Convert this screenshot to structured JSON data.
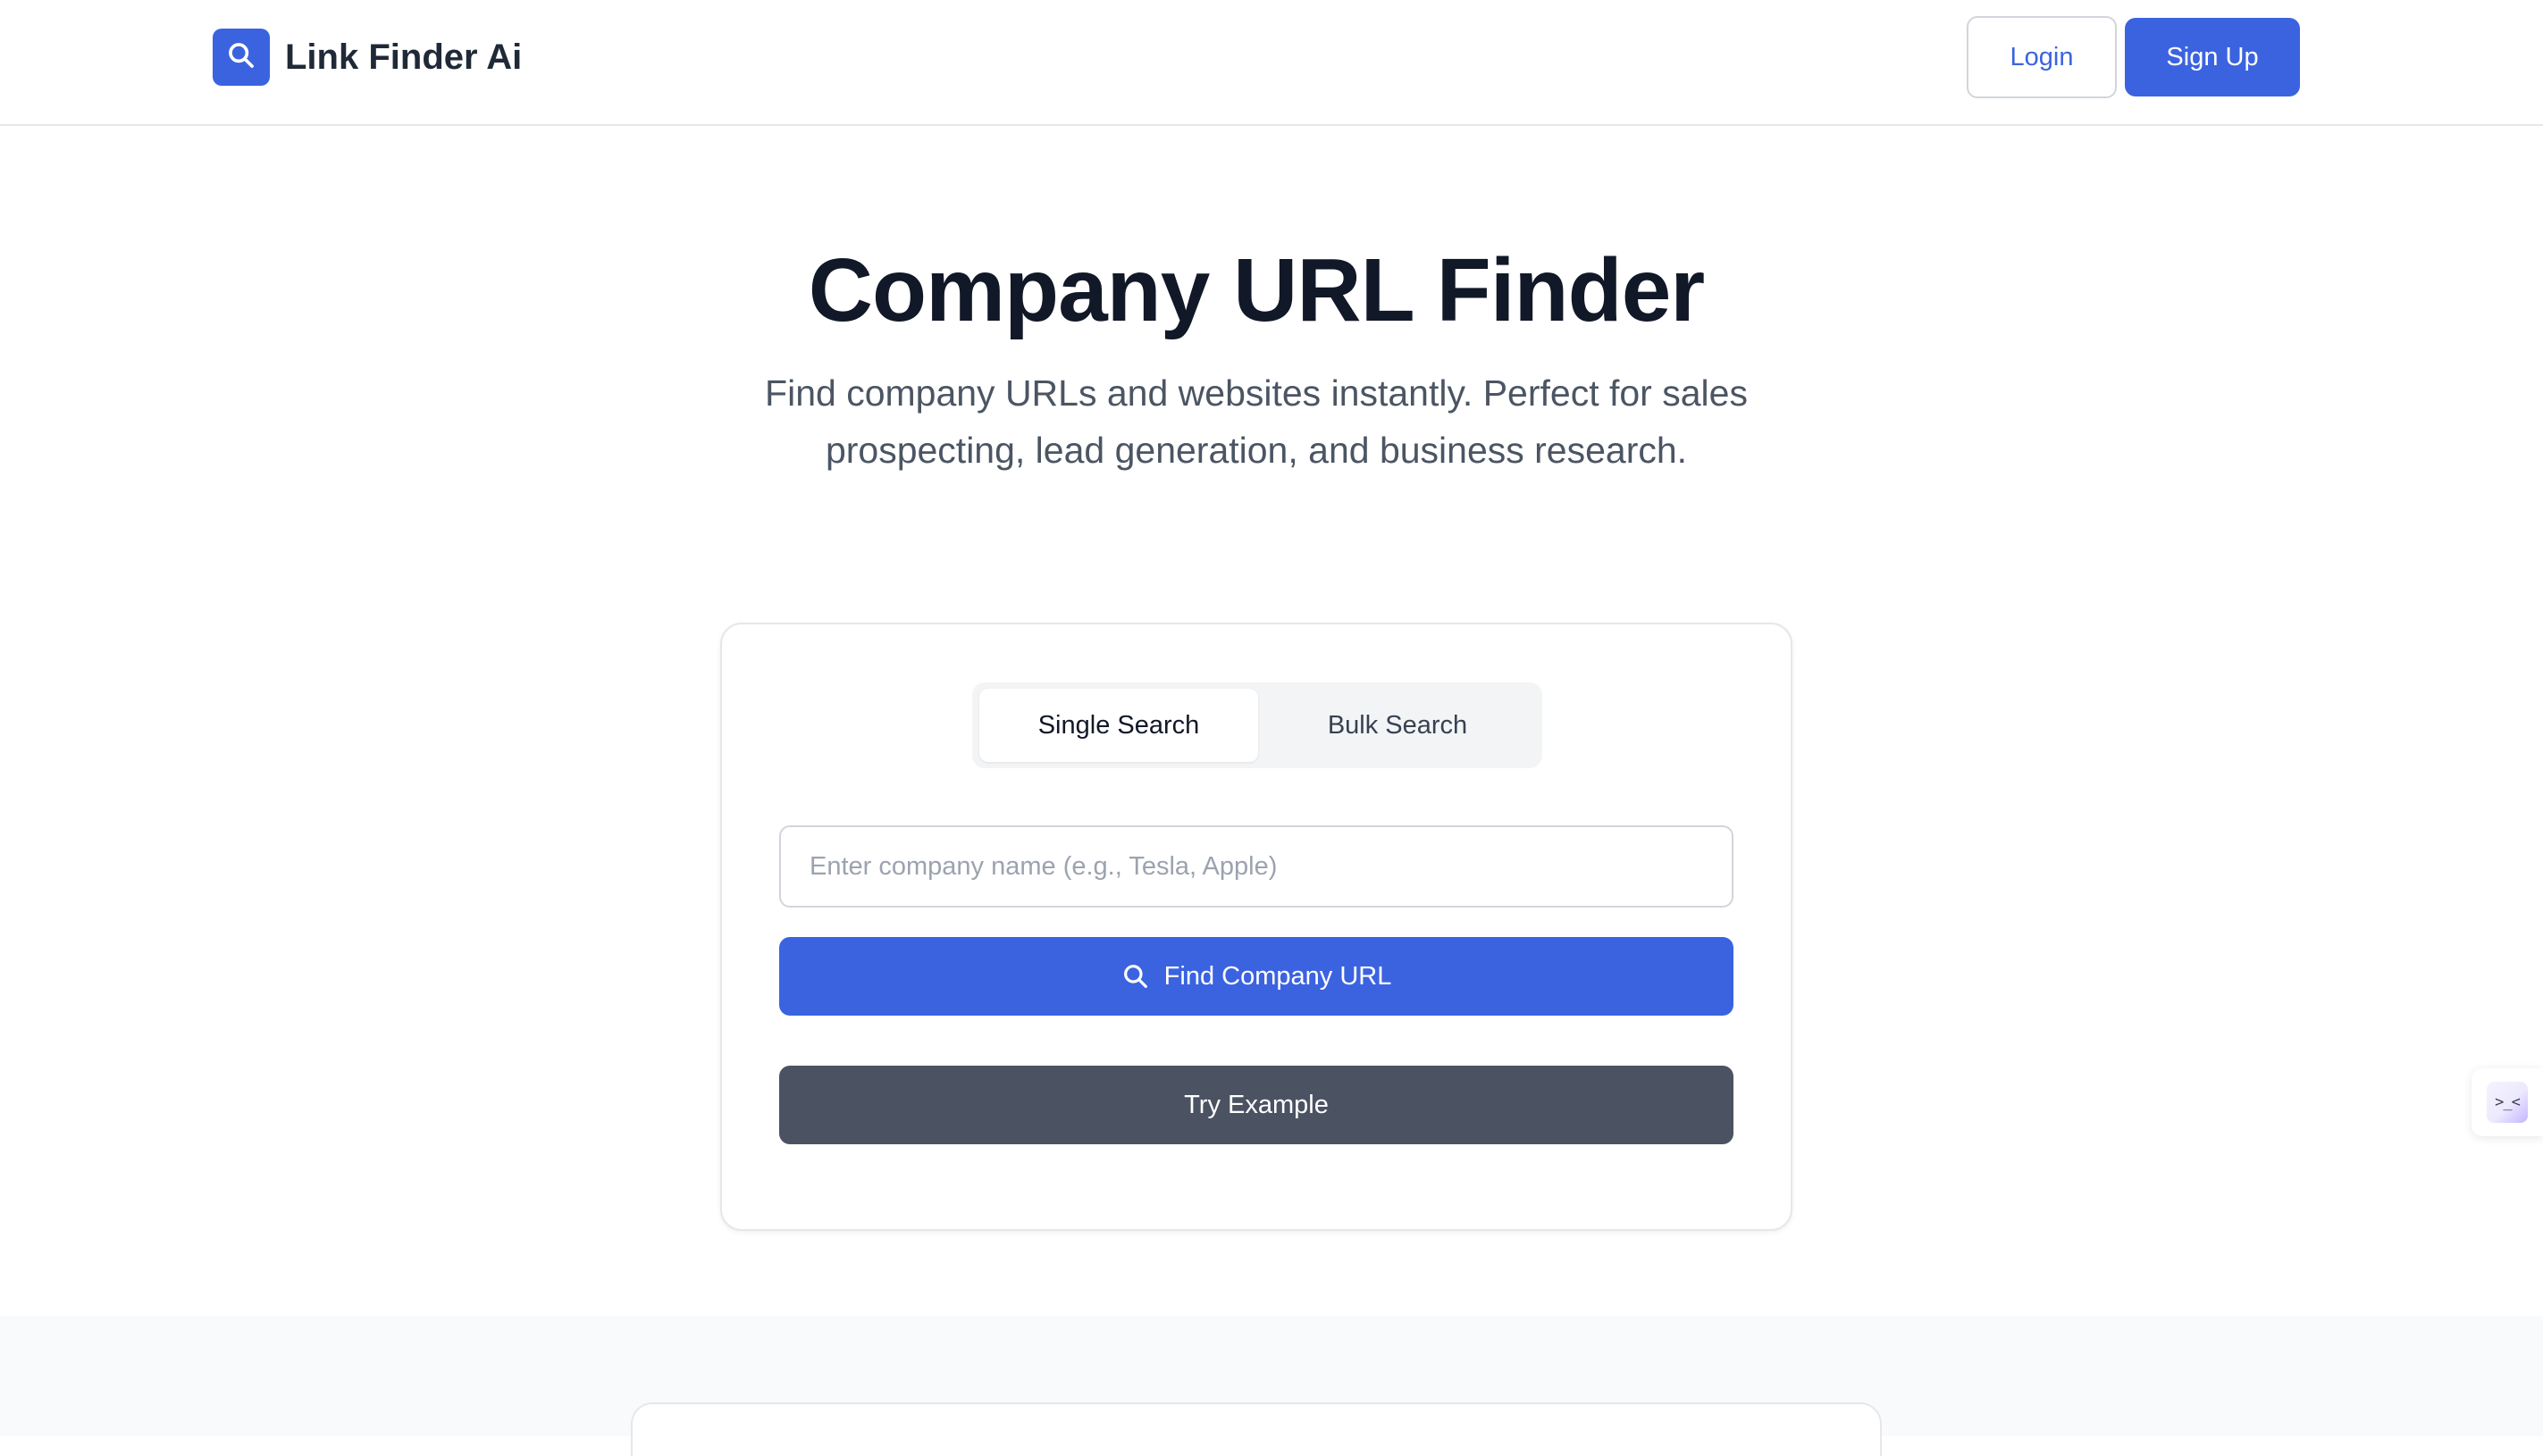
{
  "header": {
    "brand_name": "Link Finder Ai",
    "brand_icon": "search-icon",
    "login_label": "Login",
    "signup_label": "Sign Up"
  },
  "hero": {
    "title": "Company URL Finder",
    "subtitle": "Find company URLs and websites instantly. Perfect for sales prospecting, lead generation, and business research."
  },
  "search_card": {
    "tabs": [
      {
        "label": "Single Search",
        "active": true
      },
      {
        "label": "Bulk Search",
        "active": false
      }
    ],
    "input": {
      "placeholder": "Enter company name (e.g., Tesla, Apple)",
      "value": ""
    },
    "find_button_label": "Find Company URL",
    "find_button_icon": "search-icon",
    "example_button_label": "Try Example"
  },
  "floating_widget": {
    "glyph": ">_<"
  },
  "colors": {
    "primary": "#3b63e0",
    "secondary_button": "#4b5262",
    "heading": "#111827",
    "body_text": "#4b5563",
    "border": "#e5e7eb",
    "lower_section_bg": "#f9fafb"
  }
}
